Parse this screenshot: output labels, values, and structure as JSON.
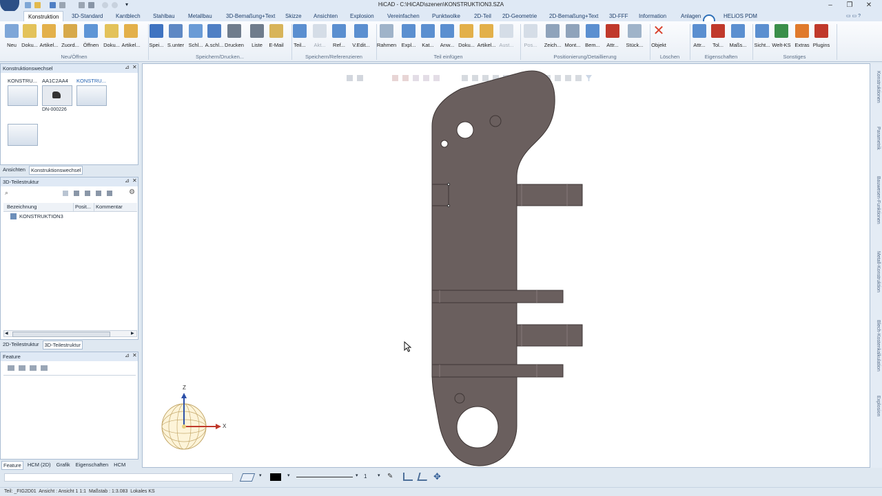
{
  "window": {
    "title": "HiCAD - C:\\HiCAD\\szenen\\KONSTRUKTION3.SZA"
  },
  "tabs": [
    "Konstruktion",
    "3D-Standard",
    "Kantblech",
    "Stahlbau",
    "Metallbau",
    "3D-Bemaßung+Text",
    "Skizze",
    "Ansichten",
    "Explosion",
    "Vereinfachen",
    "Punktwolke",
    "2D-Teil",
    "2D-Geometrie",
    "2D-Bemaßung+Text",
    "3D-FFF",
    "Information",
    "Anlagen",
    "HELiOS PDM"
  ],
  "ribbon": {
    "buttons": [
      {
        "label": "Neu",
        "icon": "new-file-icon"
      },
      {
        "label": "Doku...",
        "icon": "document-icon"
      },
      {
        "label": "Artikel...",
        "icon": "article-icon"
      },
      {
        "label": "Zuord...",
        "icon": "assign-icon"
      },
      {
        "label": "Öffnen",
        "icon": "open-folder-icon"
      },
      {
        "label": "Doku...",
        "icon": "document-icon"
      },
      {
        "label": "Artikel...",
        "icon": "article-icon"
      },
      {
        "label": "Spei...",
        "icon": "save-icon"
      },
      {
        "label": "S.unter",
        "icon": "save-as-icon"
      },
      {
        "label": "Schl...",
        "icon": "close-icon"
      },
      {
        "label": "A.schl...",
        "icon": "close-all-icon"
      },
      {
        "label": "Drucken",
        "icon": "print-icon"
      },
      {
        "label": "Liste",
        "icon": "list-icon"
      },
      {
        "label": "E-Mail",
        "icon": "email-icon"
      },
      {
        "label": "Teil...",
        "icon": "part-icon"
      },
      {
        "label": "Akt...",
        "icon": "update-icon"
      },
      {
        "label": "Ref...",
        "icon": "reference-icon"
      },
      {
        "label": "V.Edit...",
        "icon": "edit-icon"
      },
      {
        "label": "Rahmen",
        "icon": "frame-icon"
      },
      {
        "label": "Expl...",
        "icon": "explorer-icon"
      },
      {
        "label": "Kat...",
        "icon": "catalog-icon"
      },
      {
        "label": "Anw...",
        "icon": "application-icon"
      },
      {
        "label": "Doku...",
        "icon": "document-icon"
      },
      {
        "label": "Artikel...",
        "icon": "article-icon"
      },
      {
        "label": "Aust...",
        "icon": "exchange-icon"
      },
      {
        "label": "Pos...",
        "icon": "position-icon"
      },
      {
        "label": "Zeich...",
        "icon": "drawing-icon"
      },
      {
        "label": "Mont...",
        "icon": "assembly-icon"
      },
      {
        "label": "Bem...",
        "icon": "dimension-icon"
      },
      {
        "label": "Attr...",
        "icon": "attribute-icon"
      },
      {
        "label": "Stück...",
        "icon": "parts-list-icon"
      },
      {
        "label": "Objekt",
        "icon": "delete-icon"
      },
      {
        "label": "Attr...",
        "icon": "attribute-icon"
      },
      {
        "label": "Tol...",
        "icon": "tolerance-icon"
      },
      {
        "label": "Maßs...",
        "icon": "scale-icon"
      },
      {
        "label": "Sicht...",
        "icon": "view-icon"
      },
      {
        "label": "Welt-KS",
        "icon": "coordinate-system-icon"
      },
      {
        "label": "Extras",
        "icon": "tools-icon"
      },
      {
        "label": "Plugins",
        "icon": "plugin-icon"
      }
    ],
    "groups": [
      "Neu/Öffnen",
      "Speichern/Drucken...",
      "Speichern/Referenzieren",
      "Teil einfügen",
      "Positionierung/Detaillierung",
      "Löschen",
      "Eigenschaften",
      "Sonstiges"
    ]
  },
  "panel_konstruktionswechsel": {
    "title": "Konstruktionswechsel",
    "items": [
      {
        "label": "KONSTRU..."
      },
      {
        "label": "AA1C2AA4",
        "sub": "DN-000226"
      },
      {
        "label": "KONSTRU..."
      },
      {
        "label": ""
      }
    ],
    "tabs": [
      "Ansichten",
      "Konstruktionswechsel"
    ]
  },
  "panel_teilestruktur": {
    "title": "3D-Teilestruktur",
    "columns": [
      "Bezeichnung",
      "Posit...",
      "Kommentar"
    ],
    "rows": [
      {
        "name": "KONSTRUKTION3"
      }
    ],
    "tabs": [
      "2D-Teilestruktur",
      "3D-Teilestruktur"
    ]
  },
  "panel_feature": {
    "title": "Feature",
    "tabs": [
      "Feature",
      "HCM (2D)",
      "Grafik",
      "Eigenschaften",
      "HCM"
    ]
  },
  "side_tabs": [
    "Konstruktionen",
    "Parametrik",
    "Bauwesen-Funktionen",
    "Metall-Konstruktion",
    "Blech-Kostenkalkulation",
    "Explosion"
  ],
  "axes": {
    "x": "X",
    "z": "Z"
  },
  "statusbar": {
    "text": "Teil: _FIG2D01  Ansicht : Ansicht 1 1:1  Maßstab : 1:3.083  Lokales KS"
  },
  "cmdbar": {
    "line_width": "1"
  },
  "colors": {
    "part_fill": "#6a5f5e",
    "part_stroke": "#3e3635",
    "accent": "#1f4e8c"
  }
}
